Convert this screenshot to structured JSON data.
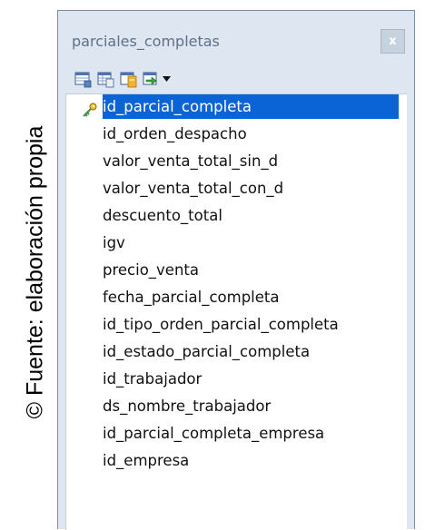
{
  "caption": {
    "text": "© Fuente: elaboración propia"
  },
  "window": {
    "title": "parciales_completas",
    "close_glyph": "x",
    "accent_color": "#0a64d6"
  },
  "toolbar": {
    "icons": [
      "table-view-icon",
      "table-grid-icon",
      "table-color-icon",
      "table-export-icon"
    ],
    "dropdown_icon": "chevron-down-icon"
  },
  "fields": [
    {
      "label": "id_parcial_completa",
      "primary_key": true,
      "selected": true
    },
    {
      "label": "id_orden_despacho"
    },
    {
      "label": "valor_venta_total_sin_d"
    },
    {
      "label": "valor_venta_total_con_d"
    },
    {
      "label": "descuento_total"
    },
    {
      "label": "igv"
    },
    {
      "label": "precio_venta"
    },
    {
      "label": "fecha_parcial_completa"
    },
    {
      "label": "id_tipo_orden_parcial_completa"
    },
    {
      "label": "id_estado_parcial_completa"
    },
    {
      "label": "id_trabajador"
    },
    {
      "label": "ds_nombre_trabajador"
    },
    {
      "label": "id_parcial_completa_empresa"
    },
    {
      "label": "id_empresa"
    }
  ]
}
